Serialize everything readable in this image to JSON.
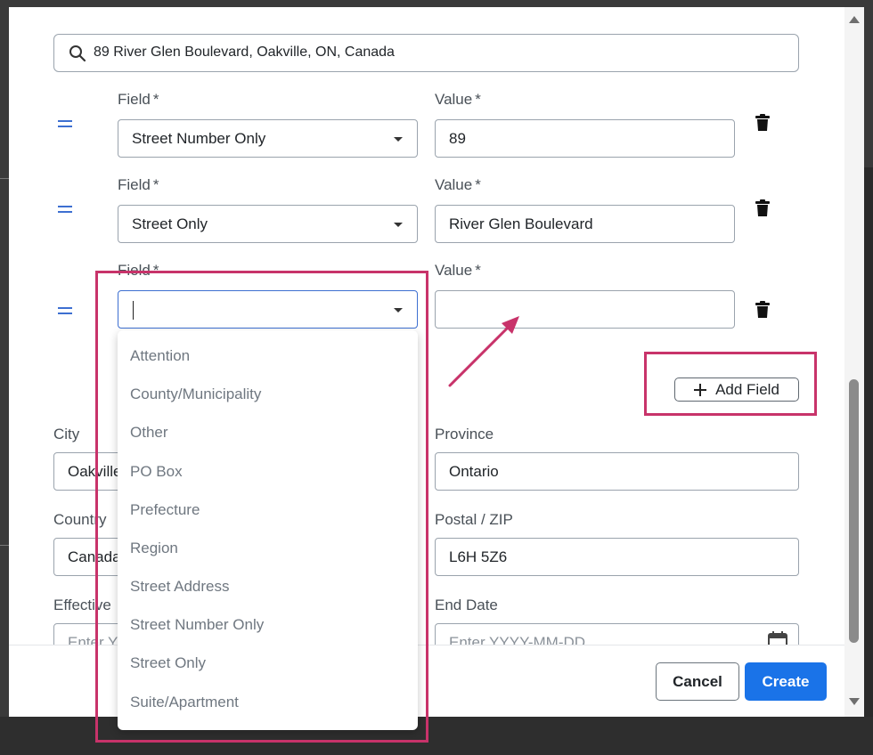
{
  "search": {
    "value": "89 River Glen Boulevard, Oakville, ON, Canada"
  },
  "field_label": "Field",
  "value_label": "Value",
  "required_mark": "*",
  "rows": [
    {
      "field": "Street Number Only",
      "value": "89"
    },
    {
      "field": "Street Only",
      "value": "River Glen Boulevard"
    },
    {
      "field": "",
      "value": ""
    }
  ],
  "add_field_label": "Add Field",
  "address": {
    "city_label": "City",
    "city_value": "Oakville",
    "province_label": "Province",
    "province_value": "Ontario",
    "country_label": "Country",
    "country_value": "Canada",
    "postal_label": "Postal / ZIP",
    "postal_value": "L6H 5Z6",
    "effective_label": "Effective",
    "effective_placeholder": "Enter YYYY-MM-DD",
    "end_date_label": "End Date",
    "end_date_placeholder": "Enter YYYY-MM-DD"
  },
  "dropdown_options": [
    "Attention",
    "County/Municipality",
    "Other",
    "PO Box",
    "Prefecture",
    "Region",
    "Street Address",
    "Street Number Only",
    "Street Only",
    "Suite/Apartment"
  ],
  "footer": {
    "cancel_label": "Cancel",
    "create_label": "Create"
  },
  "colors": {
    "primary": "#1a73e8",
    "annotation": "#c8336a",
    "drag_handle": "#3d6fd1"
  }
}
